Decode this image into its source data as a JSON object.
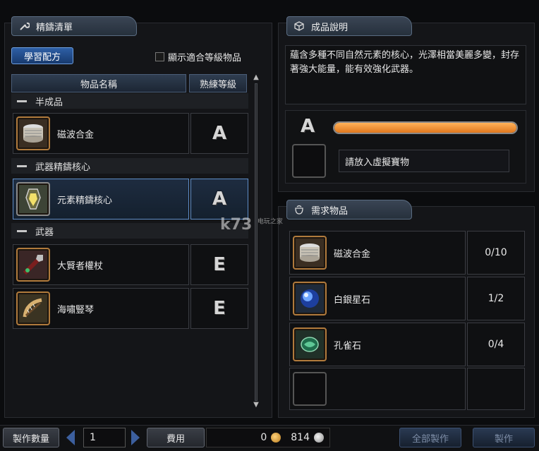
{
  "left_panel": {
    "title": "精鑄清單",
    "learn_button": "學習配方",
    "show_level_checkbox": "顯示適合等級物品",
    "columns": {
      "name": "物品名稱",
      "level": "熟練等級"
    },
    "categories": [
      {
        "label": "半成品",
        "items": [
          {
            "name": "磁波合金",
            "grade": "A",
            "icon": "alloy-icon"
          }
        ]
      },
      {
        "label": "武器精鑄核心",
        "items": [
          {
            "name": "元素精鑄核心",
            "grade": "A",
            "icon": "core-crystal-icon",
            "selected": true
          }
        ]
      },
      {
        "label": "武器",
        "items": [
          {
            "name": "大賢者權杖",
            "grade": "E",
            "icon": "scepter-icon"
          },
          {
            "name": "海嘯豎琴",
            "grade": "E",
            "icon": "harp-icon"
          }
        ]
      }
    ]
  },
  "right_panel": {
    "product_title": "成品說明",
    "description": "蘊含多種不同自然元素的核心，光澤相當美麗多變，封存著強大能量，能有效強化武器。",
    "grade": "A",
    "virtual_item_label": "請放入虛擬寶物",
    "progress": 1.0,
    "required_title": "需求物品",
    "requirements": [
      {
        "name": "磁波合金",
        "count": "0/10",
        "icon": "alloy-icon"
      },
      {
        "name": "白銀星石",
        "count": "1/2",
        "icon": "blue-orb-icon"
      },
      {
        "name": "孔雀石",
        "count": "0/4",
        "icon": "green-gem-icon"
      },
      {
        "name": "",
        "count": "",
        "icon": ""
      }
    ]
  },
  "bottom": {
    "quantity_label": "製作數量",
    "quantity": "1",
    "fee_label": "費用",
    "gold": "0",
    "silver": "814",
    "craft_all": "全部製作",
    "craft": "製作"
  },
  "watermark": {
    "text": "k73",
    "sub": "电玩之家"
  },
  "colors": {
    "accent": "#5f8ec8",
    "progress": "#f08a2a",
    "icon_frame": "#b07a3c"
  }
}
